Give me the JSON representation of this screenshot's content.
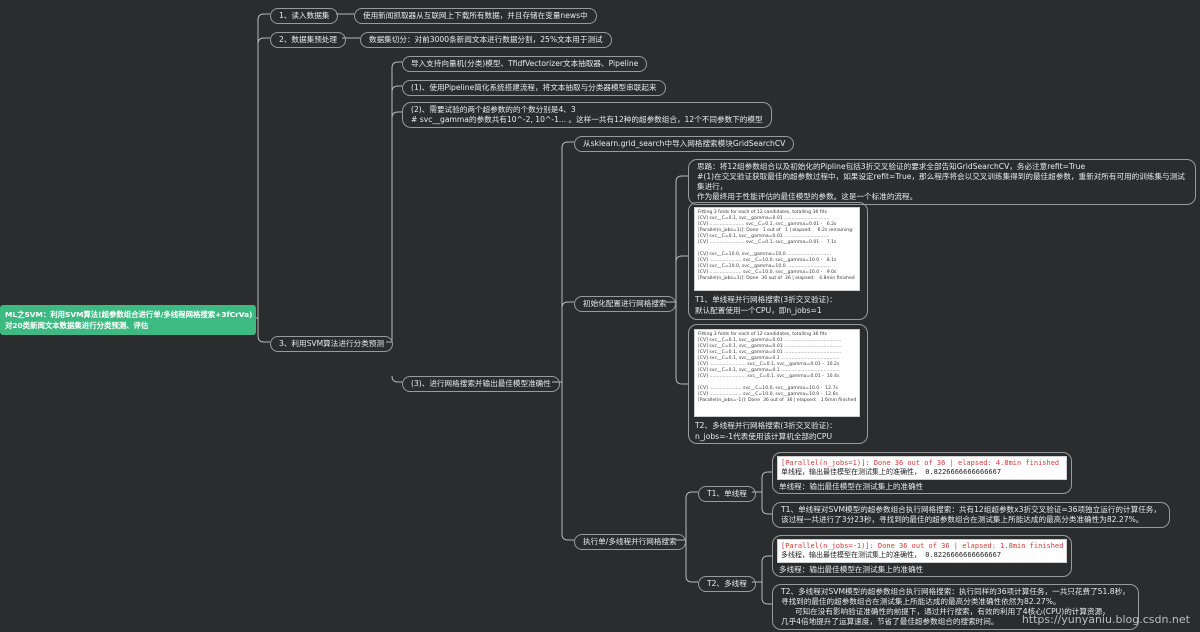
{
  "root": {
    "line1": "ML之SVM：利用SVM算法(超参数组合进行单/多线程网格搜索+3fCrVa)",
    "line2": "对20类新闻文本数据集进行分类预测、评估"
  },
  "steps": {
    "s1": "1、读入数据集",
    "s1_note": "使用新闻抓取器从互联网上下载所有数据，并且存储在变量news中",
    "s2": "2、数据集预处理",
    "s2_note": "数据集切分：对前3000条新闻文本进行数据分割，25%文本用于测试",
    "s3": "3、利用SVM算法进行分类预测"
  },
  "branch3": {
    "import": "导入支持向量机(分类)模型、TfidfVectorizer文本抽取器、Pipeline",
    "p1": "(1)、使用Pipeline简化系统搭建流程，将文本抽取与分类器模型串联起来",
    "p2_line1": "(2)、需要试验的两个超参数的的个数分别是4、3",
    "p2_line2": "# svc__gamma的参数共有10^-2, 10^-1... 。这样一共有12种的超参数组合，12个不同参数下的模型",
    "p3": "(3)、进行网格搜索并输出最佳模型准确性"
  },
  "grid": {
    "import": "从sklearn.grid_search中导入网格搜索模块GridSearchCV",
    "init": "初始化配置进行网格搜索",
    "idea_line1": "思路：将12组参数组合以及初始化的Pipline包括3折交叉验证的要求全部告知GridSearchCV，务必注意refit=True",
    "idea_line2": "#(1)在交叉验证获取最佳的超参数过程中，如果设定refit=True，那么程序将会以交叉训练集得到的最佳超参数，重新对所有可用的训练集与测试集进行，",
    "idea_line3": "作为最终用于性能评估的最佳模型的参数。这是一个标准的流程。",
    "single_cap1": "T1、单线程并行网格搜索(3折交叉验证)：",
    "single_cap2": "默认配置使用一个CPU，即n_jobs=1",
    "multi_cap1": "T2、多线程并行网格搜索(3折交叉验证)：",
    "multi_cap2": "n_jobs=-1代表使用该计算机全部的CPU",
    "shot1": [
      "Fitting 3 folds for each of 12 candidates, totalling 36 fits",
      "[CV] svc__C=0.1, svc__gamma=0.01 ...............................",
      "[CV] ........................ svc__C=0.1, svc__gamma=0.01 -   6.2s",
      "[Parallel(n_jobs=1)]: Done   1 out of   1 | elapsed:    6.2s remaining:    0.0s",
      "[CV] svc__C=0.1, svc__gamma=0.01 ...............................",
      "[CV] ........................ svc__C=0.1, svc__gamma=0.01 -   7.1s",
      "",
      "[CV] svc__C=10.0, svc__gamma=10.0 ..............................",
      "[CV] ...................... svc__C=10.0, svc__gamma=10.0 -   8.1s",
      "[CV] svc__C=10.0, svc__gamma=10.0 ..............................",
      "[CV] ...................... svc__C=10.0, svc__gamma=10.0 -   9.0s",
      "[Parallel(n_jobs=1)]: Done  36 out of  36 | elapsed:   4.8min finished"
    ],
    "shot2": [
      "Fitting 3 folds for each of 12 candidates, totalling 36 fits",
      "[CV] svc__C=0.1, svc__gamma=0.01 .......................................",
      "[CV] svc__C=0.1, svc__gamma=0.01 .......................................",
      "[CV] svc__C=0.1, svc__gamma=0.01 .......................................",
      "[CV] svc__C=0.1, svc__gamma=0.1 ........................................",
      "[CV] ......................... svc__C=0.1, svc__gamma=0.01 -  10.2s",
      "[CV] svc__C=0.1, svc__gamma=0.1 ........................................",
      "[CV] ......................... svc__C=0.1, svc__gamma=0.01 -  10.4s",
      "",
      "[CV] ...................... svc__C=10.0, svc__gamma=10.0 -  12.7s",
      "[CV] ...................... svc__C=10.0, svc__gamma=10.0 -  12.6s",
      "[Parallel(n_jobs=-1)]: Done  36 out of  36 | elapsed:   1.6min finished"
    ],
    "exec": "执行单/多线程并行网格搜索",
    "t1": "T1、单线程",
    "t1_console_red": "[Parallel(n_jobs=1)]: Done  36 out of  36 | elapsed:  4.8min finished",
    "t1_console_black": "单线程，输出最佳模型在测试集上的准确性， 0.8226666666666667",
    "t1_cap": "单线程：输出最佳模型在测试集上的准确性",
    "t1_sum_line1": "T1、单线程对SVM模型的超参数组合执行网格搜索：共有12组超参数x3折交叉验证=36项独立运行的计算任务，",
    "t1_sum_line2": "该过程一共进行了3分23秒，寻找到的最佳的超参数组合在测试集上所能达成的最高分类准确性为82.27%。",
    "t2": "T2、多线程",
    "t2_console_red": "[Parallel(n_jobs=-1)]: Done  36 out of  36 | elapsed:  1.8min finished",
    "t2_console_black": "多线程，输出最佳模型在测试集上的准确性， 0.8226666666666667",
    "t2_cap": "多线程：输出最佳模型在测试集上的准确性",
    "t2_sum_line1": "T2、多线程对SVM模型的超参数组合执行网格搜索：执行同样的36项计算任务，一共只花费了51.8秒，",
    "t2_sum_line2": "寻找到的最佳的超参数组合在测试集上所能达成的最高分类准确性依然为82.27%。",
    "t2_sum_line3": "可知在没有影响验证准确性的前提下，通过并行搜索，有效的利用了4核心(CPU)的计算资源，",
    "t2_sum_line4": "几乎4倍地提升了运算速度，节省了最佳超参数组合的搜索时间。"
  },
  "watermark": "https://yunyaniu.blog.csdn.net",
  "colors": {
    "root_bg": "#3dba82",
    "line": "#b9b9b9",
    "bg": "#2b2c2e"
  }
}
